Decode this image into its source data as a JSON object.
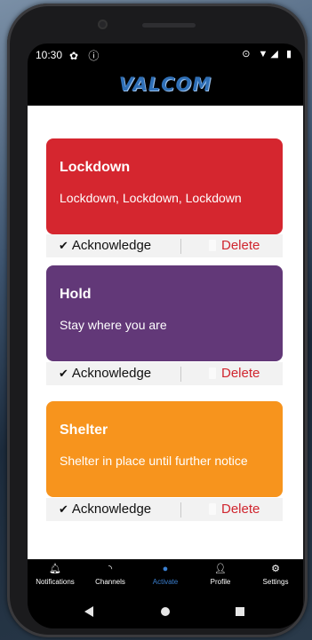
{
  "status": {
    "time": "10:30",
    "left_icons": "✿ ⓘ",
    "right_icons": "⊙ ▼◢ ▮"
  },
  "header": {
    "logo_text": "VALCOM"
  },
  "alerts": [
    {
      "title": "Lockdown",
      "message": "Lockdown, Lockdown, Lockdown",
      "color": "#d5262f",
      "acknowledge_label": "Acknowledge",
      "delete_label": "Delete"
    },
    {
      "title": "Hold",
      "message": "Stay where you are",
      "color": "#623878",
      "acknowledge_label": "Acknowledge",
      "delete_label": "Delete"
    },
    {
      "title": "Shelter",
      "message": "Shelter in place until further notice",
      "color": "#f7941d",
      "acknowledge_label": "Acknowledge",
      "delete_label": "Delete"
    }
  ],
  "nav": {
    "active": "Activate",
    "items": [
      {
        "label": "Notifications",
        "icon": "bell-icon"
      },
      {
        "label": "Channels",
        "icon": "rss-icon"
      },
      {
        "label": "Activate",
        "icon": "alert-circle-icon"
      },
      {
        "label": "Profile",
        "icon": "person-icon"
      },
      {
        "label": "Settings",
        "icon": "gear-icon"
      }
    ]
  },
  "colors": {
    "accent": "#3a7fd0",
    "delete": "#d0262f",
    "logo": "#2f6fb6"
  }
}
